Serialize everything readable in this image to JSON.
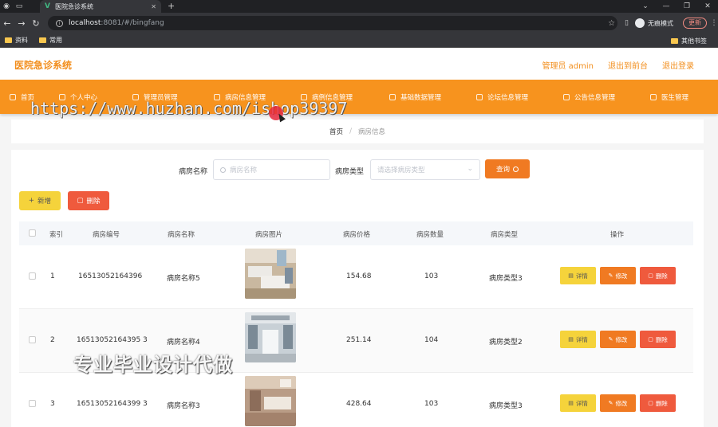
{
  "browser": {
    "tab_title": "医院急诊系统",
    "url_host": "localhost",
    "url_path": ":8081/#/bingfang",
    "profile_label": "无痕模式",
    "update_label": "更新",
    "bookmarks": [
      "资料",
      "常用"
    ],
    "other_bookmarks": "其他书签"
  },
  "app": {
    "title": "医院急诊系统",
    "admin_label": "管理员 admin",
    "frontend_link": "退出到前台",
    "logout_link": "退出登录"
  },
  "nav": {
    "items": [
      "首页",
      "个人中心",
      "管理员管理",
      "病房信息管理",
      "病例信息管理",
      "基础数据管理",
      "论坛信息管理",
      "公告信息管理",
      "医生管理"
    ]
  },
  "watermark": {
    "url_text": "https://www.huzhan.com/ishop39397",
    "promo_text": "专业毕业设计代做"
  },
  "breadcrumb": {
    "home": "首页",
    "separator": "/",
    "current": "病房信息"
  },
  "search": {
    "name_label": "病房名称",
    "name_placeholder": "病房名称",
    "type_label": "病房类型",
    "type_placeholder": "请选择病房类型",
    "query_button": "查询"
  },
  "toolbar": {
    "add_label": "新增",
    "delete_label": "删除"
  },
  "table": {
    "headers": [
      "索引",
      "病房编号",
      "病房名称",
      "病房图片",
      "病房价格",
      "病房数量",
      "病房类型",
      "操作"
    ],
    "rows": [
      {
        "index": "1",
        "code": "16513052164396",
        "name": "病房名称5",
        "price": "154.68",
        "count": "103",
        "type": "病房类型3"
      },
      {
        "index": "2",
        "code": "16513052164395 3",
        "name": "病房名称4",
        "price": "251.14",
        "count": "104",
        "type": "病房类型2"
      },
      {
        "index": "3",
        "code": "16513052164399 3",
        "name": "病房名称3",
        "price": "428.64",
        "count": "103",
        "type": "病房类型3"
      }
    ],
    "actions": {
      "detail": "详情",
      "edit": "修改",
      "delete": "删除"
    }
  },
  "colors": {
    "accent": "#f7931e",
    "title_orange": "#f28e1c",
    "detail_yellow": "#f5d33b",
    "edit_orange": "#f07a22",
    "delete_red": "#ef5a3d"
  }
}
